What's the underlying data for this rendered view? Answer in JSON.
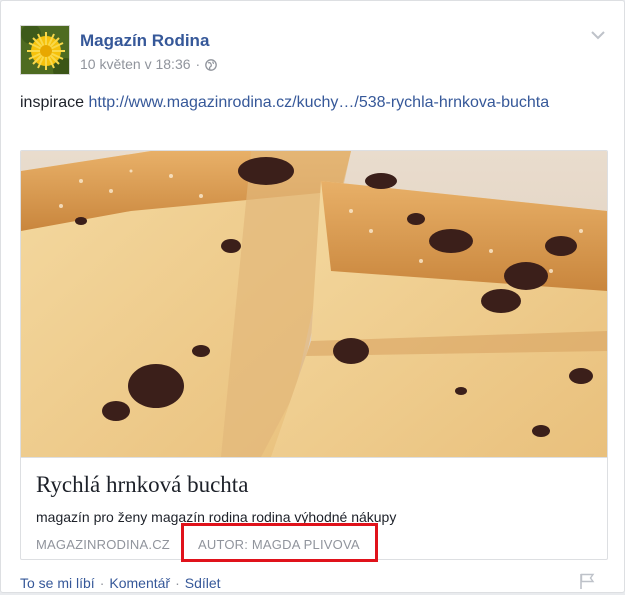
{
  "post": {
    "page_name": "Magazín Rodina",
    "timestamp": "10 květen v 18:36",
    "meta_separator": "·",
    "text_prefix": "inspirace ",
    "link_url": "http://www.magazinrodina.cz/kuchy…/538-rychla-hrnkova-buchta"
  },
  "link_card": {
    "title": "Rychlá hrnková buchta",
    "description": "magazín pro ženy magazín rodina rodina výhodné nákupy",
    "domain": "MAGAZINRODINA.CZ",
    "author": "AUTOR: MAGDA PLIVOVA"
  },
  "actions": {
    "like": "To se mi líbí",
    "comment": "Komentář",
    "share": "Sdílet",
    "separator": "·"
  },
  "colors": {
    "link_blue": "#365899",
    "meta_gray": "#90949c",
    "highlight_red": "#e0121b"
  },
  "icons": {
    "avatar": "dandelion-avatar",
    "audience": "globe-icon",
    "menu": "chevron-down-icon",
    "save": "flag-icon"
  }
}
